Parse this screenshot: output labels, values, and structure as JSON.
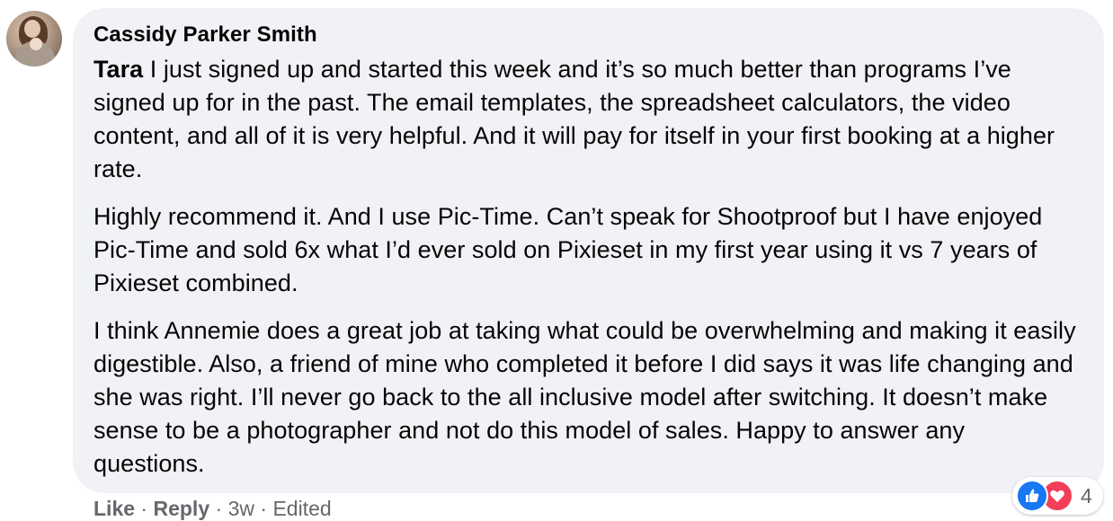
{
  "comment": {
    "author": "Cassidy Parker Smith",
    "mention": "Tara",
    "paragraphs": [
      " I just signed up and started this week and it’s so much better than programs I’ve signed up for in the past. The email templates, the spreadsheet calculators, the video content, and all of it is very helpful. And it will pay for itself in your first booking at a higher rate.",
      "Highly recommend it. And I use Pic-Time. Can’t speak for Shootproof but I have enjoyed Pic-Time and sold 6x what I’d ever sold on Pixieset in my first year using it vs 7 years of Pixieset combined.",
      "I think Annemie does a great job at taking what could be overwhelming and making it easily digestible. Also, a friend of mine who completed it before I did says it was life changing and she was right. I’ll never go back to the all inclusive model after switching. It doesn’t make sense to be a photographer and not do this model of sales. Happy to answer any questions."
    ]
  },
  "actions": {
    "like_label": "Like",
    "reply_label": "Reply",
    "separator": " · ",
    "time": "3w",
    "edited": "Edited"
  },
  "reactions": {
    "icons": [
      "like-icon",
      "love-icon"
    ],
    "count": "4",
    "colors": {
      "like": "#1877f2",
      "love": "#f33e58"
    }
  }
}
